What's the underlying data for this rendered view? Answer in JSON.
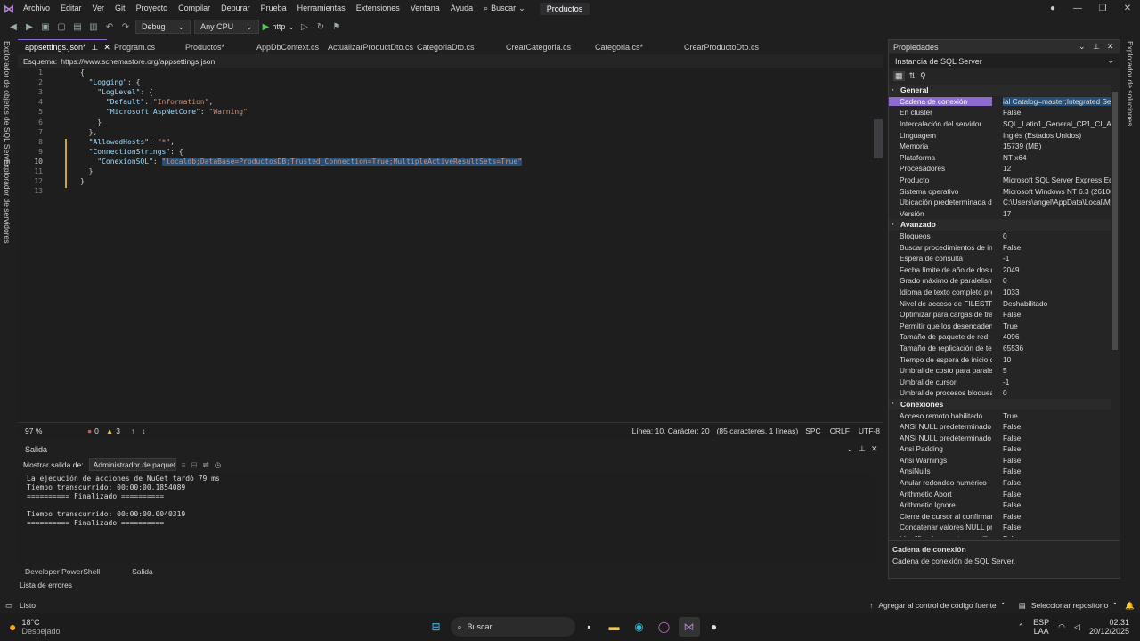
{
  "menubar": {
    "items": [
      "Archivo",
      "Editar",
      "Ver",
      "Git",
      "Proyecto",
      "Compilar",
      "Depurar",
      "Prueba",
      "Herramientas",
      "Extensiones",
      "Ventana",
      "Ayuda"
    ],
    "search_label": "Buscar",
    "product": "Productos"
  },
  "toolbar": {
    "config": "Debug",
    "platform": "Any CPU",
    "run_label": "http"
  },
  "left_tabs": [
    "Explorador de objetos de SQL Server",
    "Explorador de servidores"
  ],
  "right_tabs": [
    "Explorador de soluciones"
  ],
  "tabs": [
    "appsettings.json*",
    "Program.cs",
    "Productos*",
    "AppDbContext.cs",
    "ActualizarProductDto.cs",
    "CategoriaDto.cs",
    "CrearCategoria.cs",
    "Categoria.cs*",
    "CrearProductoDto.cs"
  ],
  "schema": {
    "label": "Esquema:",
    "url": "https://www.schemastore.org/appsettings.json"
  },
  "editor": {
    "line_numbers": [
      "1",
      "2",
      "3",
      "4",
      "5",
      "6",
      "7",
      "8",
      "9",
      "10",
      "11",
      "12",
      "13"
    ],
    "lines": [
      "{",
      "  \"Logging\": {",
      "    \"LogLevel\": {",
      "      \"Default\": \"Information\",",
      "      \"Microsoft.AspNetCore\": \"Warning\"",
      "    }",
      "  },",
      "  \"AllowedHosts\": \"*\",",
      "  \"ConnectionStrings\": {",
      "    \"ConexionSQL\": \"localdb;DataBase=ProductosDB;Trusted_Connection=True;MultipleActiveResultSets=True\"",
      "  }",
      "}",
      ""
    ],
    "current_line": "10"
  },
  "editor_status": {
    "zoom": "97 %",
    "errors": "0",
    "warnings": "3",
    "position": "Línea: 10, Carácter: 20",
    "selection": "(85 caracteres, 1 líneas)",
    "indent": "SPC",
    "eol": "CRLF",
    "encoding": "UTF-8"
  },
  "output": {
    "title": "Salida",
    "show_label": "Mostrar salida de:",
    "source": "Administrador de paquetes",
    "lines": [
      "La ejecución de acciones de NuGet tardó 79 ms",
      "Tiempo transcurrido: 00:00:00.1854089",
      "========== Finalizado ==========",
      "",
      "Tiempo transcurrido: 00:00:00.0040319",
      "========== Finalizado =========="
    ]
  },
  "bottom_tabs": [
    "Developer PowerShell",
    "Salida"
  ],
  "error_list": "Lista de errores",
  "properties": {
    "title": "Propiedades",
    "object": "Instancia de SQL Server",
    "categories": [
      {
        "name": "General",
        "rows": [
          {
            "name": "Cadena de conexión",
            "value": "ial Catalog=master;Integrated Sec",
            "selected": true
          },
          {
            "name": "En clúster",
            "value": "False"
          },
          {
            "name": "Intercalación del servidor",
            "value": "SQL_Latin1_General_CP1_CI_AS"
          },
          {
            "name": "Linguagem",
            "value": "Inglés (Estados Unidos)"
          },
          {
            "name": "Memoria",
            "value": "15739 (MB)"
          },
          {
            "name": "Plataforma",
            "value": "NT x64"
          },
          {
            "name": "Procesadores",
            "value": "12"
          },
          {
            "name": "Producto",
            "value": "Microsoft SQL Server Express Editi"
          },
          {
            "name": "Sistema operativo",
            "value": "Microsoft Windows NT 6.3 (26100)"
          },
          {
            "name": "Ubicación predeterminada de la",
            "value": "C:\\Users\\angel\\AppData\\Local\\M"
          },
          {
            "name": "Versión",
            "value": "17"
          }
        ]
      },
      {
        "name": "Avanzado",
        "rows": [
          {
            "name": "Bloqueos",
            "value": "0"
          },
          {
            "name": "Buscar procedimientos de inicio",
            "value": "False"
          },
          {
            "name": "Espera de consulta",
            "value": "-1"
          },
          {
            "name": "Fecha límite de año de dos dígit",
            "value": "2049"
          },
          {
            "name": "Grado máximo de paralelismo",
            "value": "0"
          },
          {
            "name": "Idioma de texto completo prede",
            "value": "1033"
          },
          {
            "name": "Nivel de acceso de FILESTREAM",
            "value": "Deshabilitado"
          },
          {
            "name": "Optimizar para cargas de trabajc",
            "value": "False"
          },
          {
            "name": "Permitir que los desencadenado",
            "value": "True"
          },
          {
            "name": "Tamaño de paquete de red",
            "value": "4096"
          },
          {
            "name": "Tamaño de replicación de texto",
            "value": "65536"
          },
          {
            "name": "Tiempo de espera de inicio de se",
            "value": "10"
          },
          {
            "name": "Umbral de costo para paralelism",
            "value": "5"
          },
          {
            "name": "Umbral de cursor",
            "value": "-1"
          },
          {
            "name": "Umbral de procesos bloqueados",
            "value": "0"
          }
        ]
      },
      {
        "name": "Conexiones",
        "rows": [
          {
            "name": "Acceso remoto habilitado",
            "value": "True"
          },
          {
            "name": "ANSI NULL predeterminado acti",
            "value": "False"
          },
          {
            "name": "ANSI NULL predeterminado desa",
            "value": "False"
          },
          {
            "name": "Ansi Padding",
            "value": "False"
          },
          {
            "name": "Ansi Warnings",
            "value": "False"
          },
          {
            "name": "AnsiNulls",
            "value": "False"
          },
          {
            "name": "Anular redondeo numérico",
            "value": "False"
          },
          {
            "name": "Arithmetic Abort",
            "value": "False"
          },
          {
            "name": "Arithmetic Ignore",
            "value": "False"
          },
          {
            "name": "Cierre de cursor al confirmar",
            "value": "False"
          },
          {
            "name": "Concatenar valores NULL produ",
            "value": "False"
          },
          {
            "name": "Identificadores entre comillas",
            "value": "False"
          }
        ]
      }
    ],
    "desc_title": "Cadena de conexión",
    "desc_text": "Cadena de conexión de SQL Server."
  },
  "statusbar": {
    "ready": "Listo",
    "source_control": "Agregar al control de código fuente",
    "repo": "Seleccionar repositorio"
  },
  "taskbar": {
    "weather_temp": "18°C",
    "weather_desc": "Despejado",
    "search": "Buscar",
    "lang": "ESP",
    "region": "LAA",
    "time": "02:31",
    "date": "20/12/2025"
  }
}
